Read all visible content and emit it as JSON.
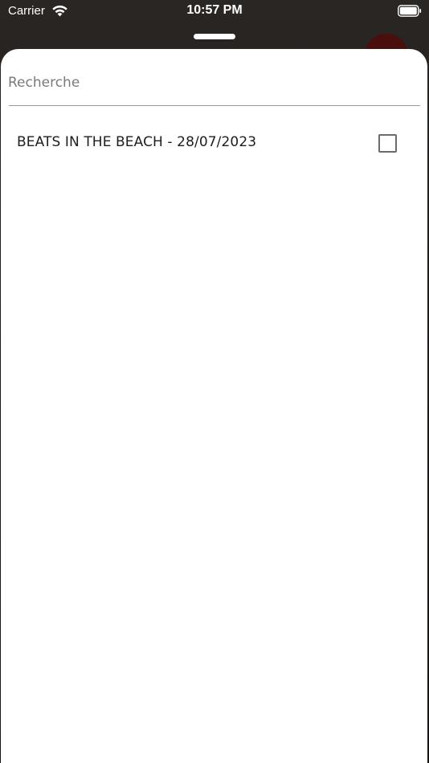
{
  "status_bar": {
    "carrier": "Carrier",
    "time": "10:57 PM",
    "wifi_icon": "wifi-icon",
    "battery_icon": "battery-icon"
  },
  "search": {
    "placeholder": "Recherche",
    "value": ""
  },
  "items": [
    {
      "label": "BEATS IN THE BEACH - 28/07/2023",
      "checked": false
    }
  ],
  "colors": {
    "sheet_background": "#ffffff",
    "checkbox_border": "#6b6b6b",
    "text": "#1e1e1e",
    "placeholder": "#7a7a7a"
  }
}
